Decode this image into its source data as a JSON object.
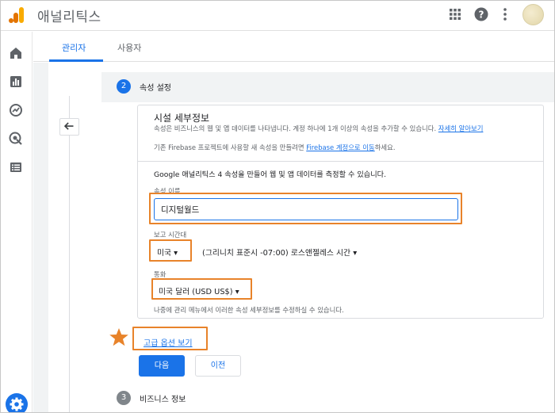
{
  "app": {
    "title": "애널리틱스"
  },
  "colors": {
    "accent": "#1a73e8",
    "highlight": "#e8832a",
    "muted": "#80868b"
  },
  "header_icons": [
    "apps-grid-icon",
    "help-icon",
    "more-vert-icon",
    "avatar"
  ],
  "leftnav": {
    "icons": [
      "home-icon",
      "reports-icon",
      "explore-icon",
      "advertising-icon",
      "list-icon"
    ],
    "settings_icon": "settings-icon"
  },
  "tabs": [
    {
      "label": "관리자",
      "active": true
    },
    {
      "label": "사용자",
      "active": false
    }
  ],
  "steps": {
    "current": {
      "number": "2",
      "label": "속성 설정"
    },
    "next": {
      "number": "3",
      "label": "비즈니스 정보"
    }
  },
  "card": {
    "title": "시설 세부정보",
    "desc": "속성은 비즈니스의 웹 및 앱 데이터를 나타냅니다. 계정 하나에 1개 이상의 속성을 추가할 수 있습니다.",
    "desc_link": "자세히 알아보기",
    "desc2_prefix": "기존 Firebase 프로젝트에 사용할 새 속성을 만들려면",
    "desc2_link": "Firebase 계정으로 이동",
    "desc2_suffix": "하세요.",
    "intro": "Google 애널리틱스 4 속성을 만들어 웹 및 앱 데이터를 측정할 수 있습니다.",
    "name_label": "속성 이름",
    "name_value": "디지털월드",
    "timezone_label": "보고 시간대",
    "timezone_country": "미국",
    "timezone_zone": "(그리니치 표준시 -07:00) 로스앤젤레스 시간",
    "currency_label": "통화",
    "currency_value": "미국 달러 (USD US$)",
    "footer_note": "나중에 관리 메뉴에서 이러한 속성 세부정보를 수정하실 수 있습니다."
  },
  "advanced_link": "고급 옵션 보기",
  "buttons": {
    "next": "다음",
    "prev": "이전"
  }
}
